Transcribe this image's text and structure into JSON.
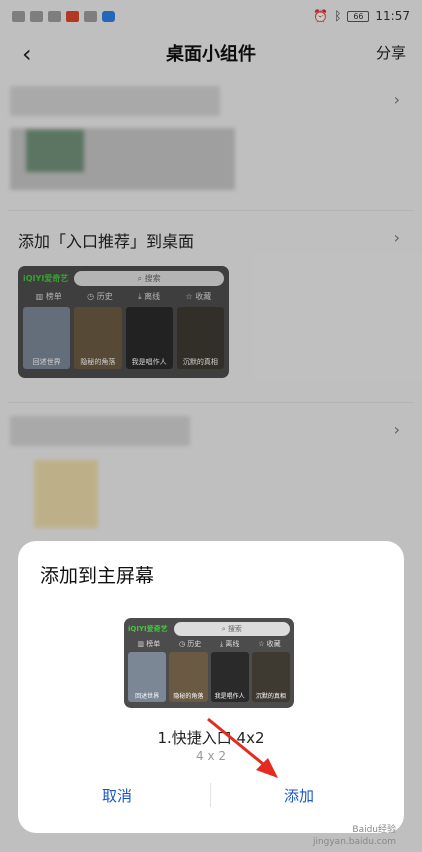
{
  "status_bar": {
    "battery": "66",
    "time": "11:57"
  },
  "header": {
    "title": "桌面小组件",
    "share_label": "分享"
  },
  "row2": {
    "title": "添加「入口推荐」到桌面"
  },
  "widget": {
    "brand": "iQIYI爱奇艺",
    "search_label": "搜索",
    "tabs": [
      "榜单",
      "历史",
      "离线",
      "收藏"
    ],
    "posters": [
      "回述世界",
      "隐秘的角落",
      "我是唱作人",
      "沉默的真相"
    ]
  },
  "sheet": {
    "title": "添加到主屏幕",
    "widget_name": "1.快捷入口 4x2",
    "widget_size": "4 x 2",
    "cancel_label": "取消",
    "add_label": "添加"
  },
  "watermark": {
    "line1": "Baidu经验",
    "line2": "jingyan.baidu.com"
  },
  "colors": {
    "accent": "#1a56c8",
    "arrow": "#e52b20",
    "brand_green": "#41c83a"
  }
}
